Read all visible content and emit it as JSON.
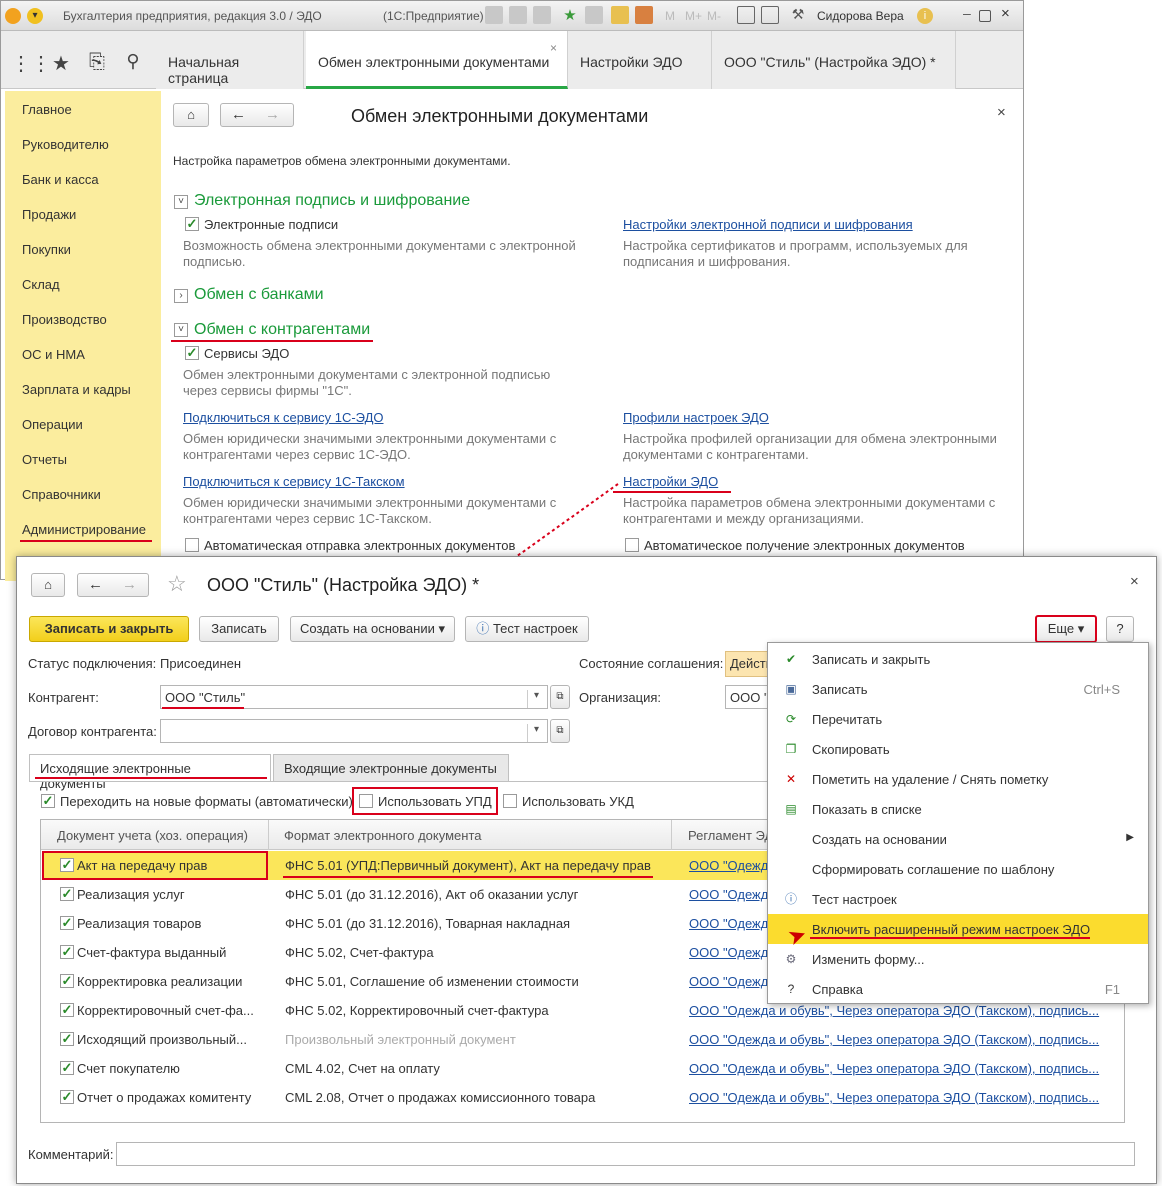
{
  "titlebar": {
    "app_title": "Бухгалтерия предприятия, редакция 3.0 / ЭДО",
    "platform": "(1С:Предприятие)",
    "m_labels": [
      "M",
      "M+",
      "M-"
    ],
    "user": "Сидорова Вера"
  },
  "tabs": [
    {
      "label": "Начальная страница"
    },
    {
      "label": "Обмен электронными документами"
    },
    {
      "label": "Настройки ЭДО"
    },
    {
      "label": "ООО \"Стиль\" (Настройка ЭДО) *"
    }
  ],
  "close_glyph": "×",
  "sidebar": {
    "items": [
      "Главное",
      "Руководителю",
      "Банк и касса",
      "Продажи",
      "Покупки",
      "Склад",
      "Производство",
      "ОС и НМА",
      "Зарплата и кадры",
      "Операции",
      "Отчеты",
      "Справочники",
      "Администрирование"
    ]
  },
  "main": {
    "title": "Обмен электронными документами",
    "intro": "Настройка параметров обмена электронными документами.",
    "section1": {
      "title": "Электронная подпись и шифрование",
      "cb_label": "Электронные подписи",
      "cb_desc": "Возможность обмена электронными документами с электронной подписью.",
      "link": "Настройки электронной подписи и шифрования",
      "link_desc": "Настройка сертификатов и программ, используемых для подписания и шифрования."
    },
    "section2": {
      "title": "Обмен с банками"
    },
    "section3": {
      "title": "Обмен с контрагентами",
      "cb_label": "Сервисы ЭДО",
      "cb_desc": "Обмен электронными документами с электронной подписью через сервисы фирмы \"1С\".",
      "link1": "Подключиться к сервису 1С-ЭДО",
      "link1_desc": "Обмен юридически значимыми электронными документами с контрагентами через сервис 1С-ЭДО.",
      "link2": "Профили настроек ЭДО",
      "link2_desc": "Настройка профилей организации для обмена электронными документами с контрагентами.",
      "link3": "Подключиться к сервису 1С-Такском",
      "link3_desc": "Обмен юридически значимыми электронными документами с контрагентами через сервис 1С-Такском.",
      "link4": "Настройки ЭДО",
      "link4_desc": "Настройка параметров обмена электронными документами с контрагентами и между организациями.",
      "auto_send": "Автоматическая отправка электронных документов",
      "auto_recv": "Автоматическое получение электронных документов"
    }
  },
  "form": {
    "title": "ООО \"Стиль\" (Настройка ЭДО) *",
    "buttons": {
      "save_close": "Записать и закрыть",
      "save": "Записать",
      "create_based": "Создать на основании",
      "test": "Тест настроек",
      "more": "Еще",
      "help": "?"
    },
    "status_label": "Статус подключения:",
    "status_value": "Присоединен",
    "agreement_label": "Состояние соглашения:",
    "agreement_value": "Действ",
    "counterparty_label": "Контрагент:",
    "counterparty_value": "ООО \"Стиль\"",
    "org_label": "Организация:",
    "org_value": "ООО \"",
    "contract_label": "Договор контрагента:",
    "contract_value": "",
    "tab_out": "Исходящие электронные документы",
    "tab_in": "Входящие электронные документы",
    "cb_new_formats": "Переходить на новые форматы (автоматически)",
    "cb_upd": "Использовать УПД",
    "cb_ukd": "Использовать УКД",
    "columns": [
      "Документ учета (хоз. операция)",
      "Формат электронного документа",
      "Регламент ЭД"
    ],
    "rows": [
      {
        "doc": "Акт на передачу прав",
        "format": "ФНС 5.01 (УПД:Первичный документ), Акт на передачу прав",
        "reg": "ООО \"Одежда"
      },
      {
        "doc": "Реализация услуг",
        "format": "ФНС 5.01 (до 31.12.2016), Акт об оказании услуг",
        "reg": "ООО \"Одежда"
      },
      {
        "doc": "Реализация товаров",
        "format": "ФНС 5.01 (до 31.12.2016), Товарная накладная",
        "reg": "ООО \"Одежда"
      },
      {
        "doc": "Счет-фактура выданный",
        "format": "ФНС 5.02, Счет-фактура",
        "reg": "ООО \"Одежда"
      },
      {
        "doc": "Корректировка реализации",
        "format": "ФНС 5.01, Соглашение об изменении стоимости",
        "reg": "ООО \"Одежда"
      },
      {
        "doc": "Корректировочный счет-фа...",
        "format": "ФНС 5.02, Корректировочный счет-фактура",
        "reg": "ООО \"Одежда и обувь\", Через оператора ЭДО (Такском), подпись..."
      },
      {
        "doc": "Исходящий произвольный...",
        "format": "Произвольный электронный документ",
        "reg": "ООО \"Одежда и обувь\", Через оператора ЭДО (Такском), подпись..."
      },
      {
        "doc": "Счет покупателю",
        "format": "CML 4.02, Счет на оплату",
        "reg": "ООО \"Одежда и обувь\", Через оператора ЭДО (Такском), подпись..."
      },
      {
        "doc": "Отчет о продажах комитенту",
        "format": "CML 2.08, Отчет о продажах комиссионного товара",
        "reg": "ООО \"Одежда и обувь\", Через оператора ЭДО (Такском), подпись..."
      }
    ],
    "comment_label": "Комментарий:"
  },
  "menu": {
    "items": [
      {
        "label": "Записать и закрыть",
        "shortcut": "",
        "icon": "save-close-icon"
      },
      {
        "label": "Записать",
        "shortcut": "Ctrl+S",
        "icon": "floppy-icon"
      },
      {
        "label": "Перечитать",
        "shortcut": "",
        "icon": "reload-icon"
      },
      {
        "label": "Скопировать",
        "shortcut": "",
        "icon": "copy-icon"
      },
      {
        "label": "Пометить на удаление / Снять пометку",
        "shortcut": "",
        "icon": "delete-mark-icon"
      },
      {
        "label": "Показать в списке",
        "shortcut": "",
        "icon": "show-in-list-icon"
      },
      {
        "label": "Создать на основании",
        "shortcut": "",
        "icon": ""
      },
      {
        "label": "Сформировать соглашение по шаблону",
        "shortcut": "",
        "icon": ""
      },
      {
        "label": "Тест настроек",
        "shortcut": "",
        "icon": "info-icon"
      },
      {
        "label": "Включить расширенный режим настроек ЭДО",
        "shortcut": "",
        "icon": ""
      },
      {
        "label": "Изменить форму...",
        "shortcut": "",
        "icon": "gear-icon"
      },
      {
        "label": "Справка",
        "shortcut": "F1",
        "icon": "help-icon"
      }
    ]
  }
}
